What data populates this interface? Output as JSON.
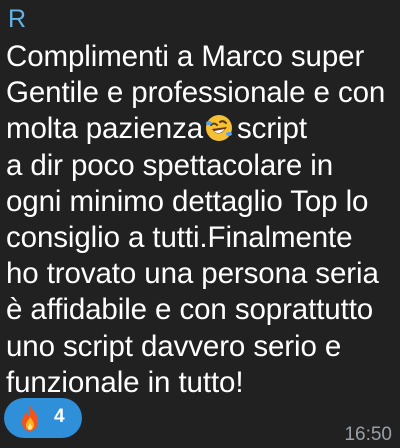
{
  "message": {
    "sender_initial": "R",
    "lines": [
      "Complimenti a Marco super",
      "Gentile e professionale e con",
      "molta pazienza",
      "script",
      "a dir poco spettacolare in",
      "ogni minimo dettaglio Top lo",
      "consiglio a tutti.Finalmente",
      "ho trovato una persona seria",
      "è affidabile e con soprattutto",
      "uno script davvero serio e",
      "funzionale in tutto!"
    ],
    "inline_emoji": "rolling-on-floor-laughing",
    "time": "16:50"
  },
  "reaction": {
    "emoji": "fire",
    "count": "4"
  },
  "colors": {
    "background": "#212121",
    "sender": "#62b4e6",
    "text": "#ffffff",
    "reaction_bg": "#2f8fd8",
    "time": "#9aa0a6"
  }
}
